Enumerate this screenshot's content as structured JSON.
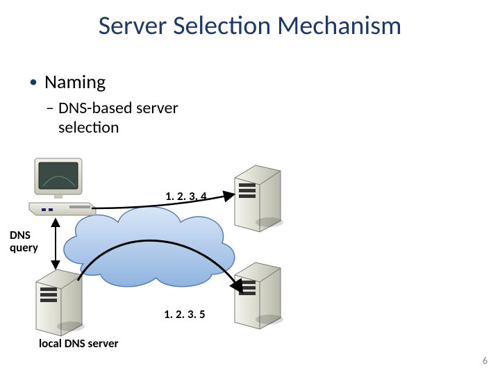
{
  "title": "Server Selection Mechanism",
  "bullets": {
    "l1": "Naming",
    "l2": "DNS-based server selection"
  },
  "labels": {
    "dns_query": "DNS\nquery",
    "ip_top": "1. 2. 3. 4",
    "ip_bottom": "1. 2. 3. 5",
    "local_dns": "local DNS server"
  },
  "page_number": "6"
}
